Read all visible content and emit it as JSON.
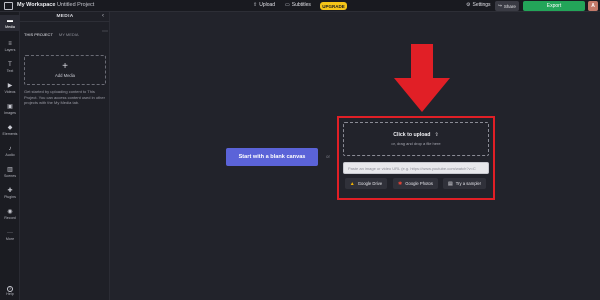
{
  "topbar": {
    "workspace_title": "My Workspace",
    "project_title": "Untitled Project",
    "upload_label": "Upload",
    "subtitles_label": "Subtitles",
    "upgrade_label": "UPGRADE",
    "settings_label": "Settings",
    "share_label": "Share",
    "export_label": "Export",
    "avatar_letter": "A"
  },
  "rail": {
    "items": [
      {
        "label": "Media",
        "icon": "folder-icon"
      },
      {
        "label": "Layers",
        "icon": "layers-icon"
      },
      {
        "label": "Text",
        "icon": "text-icon"
      },
      {
        "label": "Videos",
        "icon": "video-icon"
      },
      {
        "label": "Images",
        "icon": "image-icon"
      },
      {
        "label": "Elements",
        "icon": "shapes-icon"
      },
      {
        "label": "Audio",
        "icon": "music-icon"
      },
      {
        "label": "Scenes",
        "icon": "scenes-icon"
      },
      {
        "label": "Plugins",
        "icon": "plugin-icon"
      },
      {
        "label": "Record",
        "icon": "record-icon"
      },
      {
        "label": "More",
        "icon": "more-icon"
      }
    ],
    "help_label": "Help"
  },
  "panel": {
    "title": "MEDIA",
    "tabs": [
      "THIS PROJECT",
      "MY MEDIA"
    ],
    "add_media_label": "Add Media",
    "description": "Get started by uploading content to This Project. You can access content used in other projects with the My Media tab."
  },
  "canvas": {
    "blank_button_label": "Start with a blank canvas",
    "or_label": "or",
    "upload_title": "Click to upload",
    "upload_sub": "or, drag and drop a file here",
    "url_placeholder": "Paste an image or video URL (e.g. https://www.youtube.com/watch?v=C",
    "google_drive_label": "Google Drive",
    "google_photos_label": "Google Photos",
    "sample_label": "Try a sample!"
  },
  "colors": {
    "accent": "#5b63d8",
    "export": "#23a559",
    "upgrade": "#f5c518",
    "highlight": "#e11f26"
  }
}
